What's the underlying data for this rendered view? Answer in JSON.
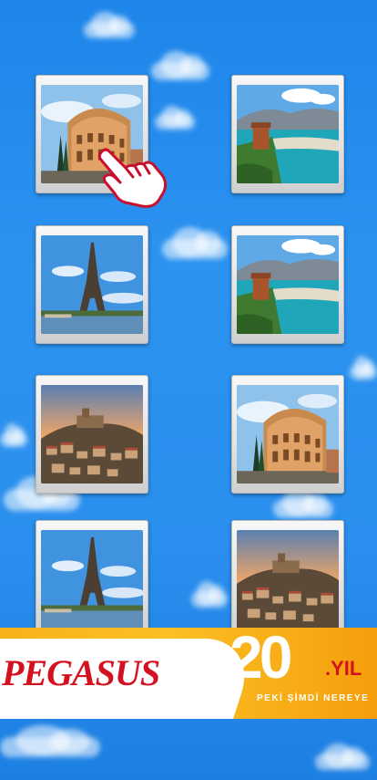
{
  "game": {
    "type": "memory-match",
    "cards": [
      {
        "id": "card-1",
        "image": "colosseum-rome",
        "state": "revealed"
      },
      {
        "id": "card-2",
        "image": "alanya-castle-coast",
        "state": "revealed"
      },
      {
        "id": "card-3",
        "image": "eiffel-tower-paris",
        "state": "revealed"
      },
      {
        "id": "card-4",
        "image": "alanya-castle-coast",
        "state": "revealed"
      },
      {
        "id": "card-5",
        "image": "hilltop-castle-town",
        "state": "revealed"
      },
      {
        "id": "card-6",
        "image": "colosseum-rome",
        "state": "revealed"
      },
      {
        "id": "card-7",
        "image": "eiffel-tower-paris",
        "state": "revealed"
      },
      {
        "id": "card-8",
        "image": "hilltop-castle-town",
        "state": "revealed"
      }
    ],
    "hint": "pointing-hand-icon"
  },
  "banner": {
    "brand": "PEGASUS",
    "anniversary_number": "20",
    "anniversary_suffix": ".YIL",
    "tagline": "PEKİ ŞİMDİ NEREYE"
  },
  "colors": {
    "sky": "#2a8fee",
    "banner_yellow": "#fbbf24",
    "brand_red": "#d5101f"
  }
}
